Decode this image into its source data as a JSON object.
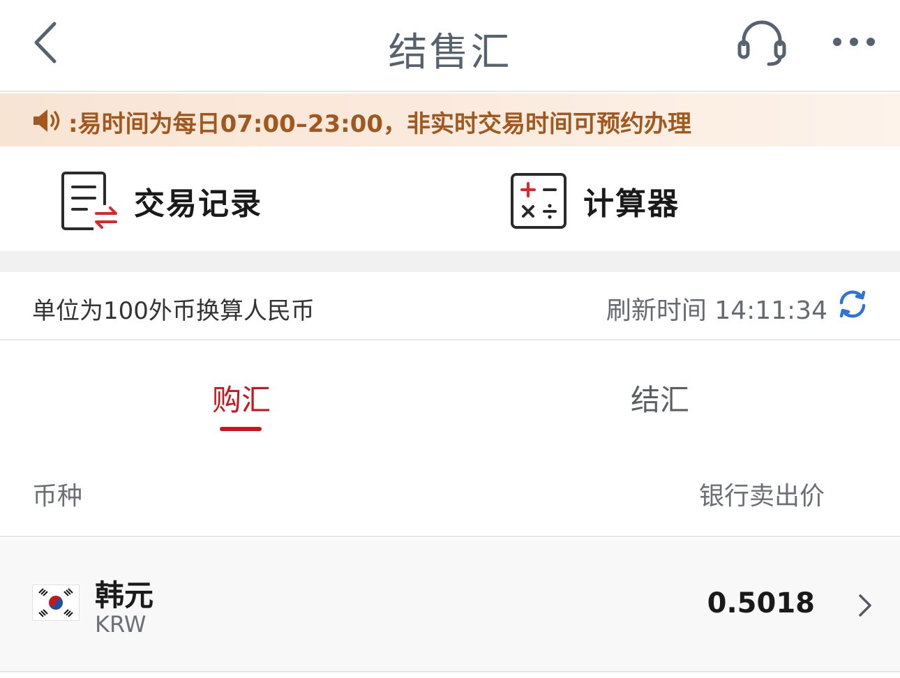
{
  "header": {
    "title": "结售汇",
    "back_icon": "chevron-left-icon",
    "service_icon": "headset-icon",
    "more_icon": "more-dots-icon"
  },
  "notice": {
    "icon": "speaker-icon",
    "text": ":易时间为每日07:00–23:00，非实时交易时间可预约办理"
  },
  "actions": {
    "records_label": "交易记录",
    "calculator_label": "计算器"
  },
  "info": {
    "unit_text": "单位为100外币换算人民币",
    "refresh_label": "刷新时间 14:11:34",
    "refresh_icon": "refresh-icon"
  },
  "tabs": [
    {
      "label": "购汇",
      "active": true
    },
    {
      "label": "结汇",
      "active": false
    }
  ],
  "columns": {
    "currency": "币种",
    "price": "银行卖出价"
  },
  "rates": [
    {
      "name": "韩元",
      "code": "KRW",
      "price": "0.5018",
      "flag_icon": "korea-flag-icon"
    }
  ],
  "colors": {
    "accent_red": "#c8161d",
    "notice_text": "#a1581f",
    "refresh_blue": "#2f73d9",
    "title_gray": "#56636e"
  }
}
